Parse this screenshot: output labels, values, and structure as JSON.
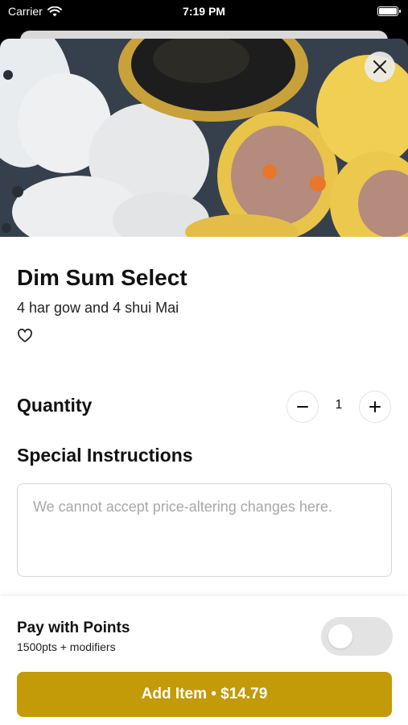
{
  "status_bar": {
    "carrier": "Carrier",
    "time": "7:19 PM"
  },
  "item": {
    "title": "Dim Sum Select",
    "description": "4 har gow and 4 shui Mai",
    "image_alt": "dim sum photo"
  },
  "quantity": {
    "label": "Quantity",
    "value": "1"
  },
  "special_instructions": {
    "label": "Special Instructions",
    "placeholder": "We cannot accept price-altering changes here."
  },
  "pay_with_points": {
    "title": "Pay with Points",
    "subtitle": "1500pts + modifiers",
    "enabled": false
  },
  "add_button": {
    "label": "Add Item • $14.79"
  },
  "colors": {
    "accent": "#c39a07",
    "toggle_off": "#e3e3e3"
  },
  "icons": [
    "wifi-icon",
    "battery-icon",
    "close-icon",
    "heart-icon",
    "minus-icon",
    "plus-icon"
  ]
}
